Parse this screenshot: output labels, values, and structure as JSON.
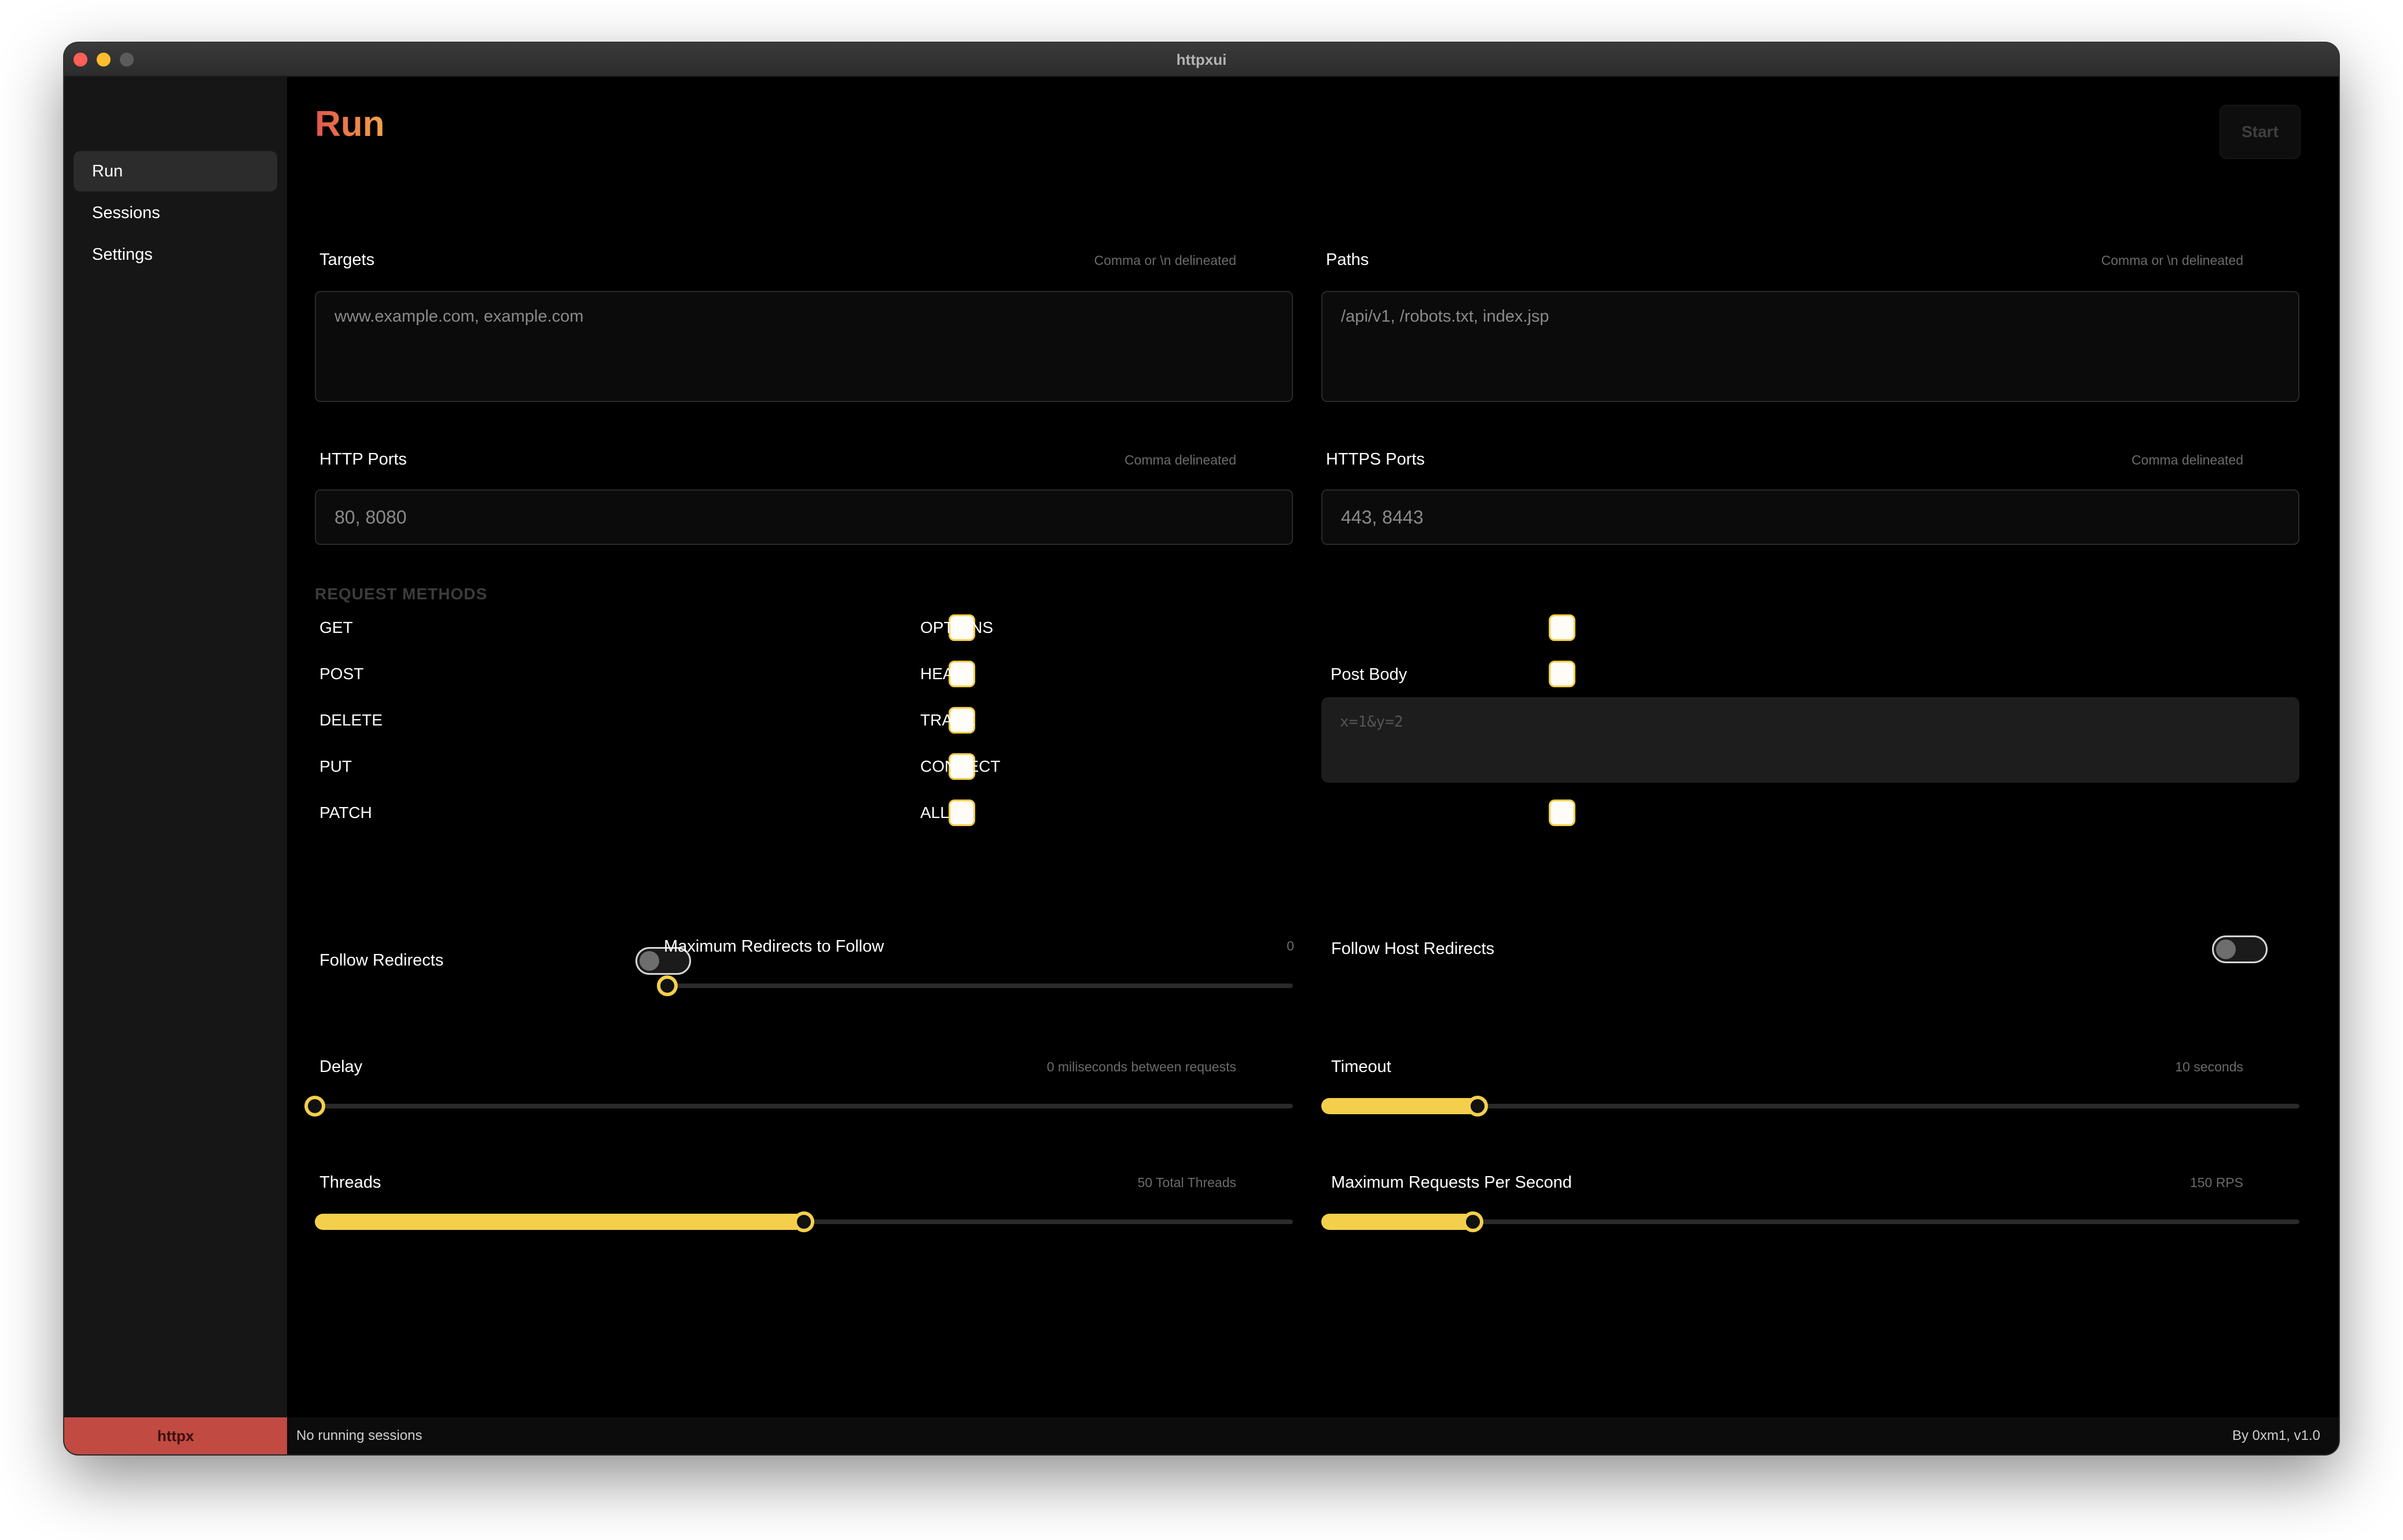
{
  "window": {
    "title": "httpxui"
  },
  "sidebar": {
    "items": [
      {
        "label": "Run",
        "active": true
      },
      {
        "label": "Sessions",
        "active": false
      },
      {
        "label": "Settings",
        "active": false
      }
    ]
  },
  "page": {
    "title": "Run",
    "start_label": "Start"
  },
  "targets": {
    "label": "Targets",
    "hint": "Comma or \\n delineated",
    "placeholder": "www.example.com, example.com"
  },
  "paths": {
    "label": "Paths",
    "hint": "Comma or \\n delineated",
    "placeholder": "/api/v1, /robots.txt, index.jsp"
  },
  "http_ports": {
    "label": "HTTP Ports",
    "hint": "Comma delineated",
    "placeholder": "80, 8080"
  },
  "https_ports": {
    "label": "HTTPS Ports",
    "hint": "Comma delineated",
    "placeholder": "443, 8443"
  },
  "methods": {
    "title": "REQUEST METHODS",
    "left": [
      "GET",
      "POST",
      "DELETE",
      "PUT",
      "PATCH"
    ],
    "right": [
      "OPTIONS",
      "HEAD",
      "TRACE",
      "CONNECT",
      "ALL"
    ]
  },
  "post_body": {
    "label": "Post Body",
    "placeholder": "x=1&y=2"
  },
  "follow_redirects": {
    "label": "Follow Redirects",
    "on": false
  },
  "max_redirects": {
    "label": "Maximum Redirects to Follow",
    "value_text": "0",
    "fraction": 0.0
  },
  "follow_host_redirects": {
    "label": "Follow Host Redirects",
    "on": false
  },
  "delay": {
    "label": "Delay",
    "hint": "0 miliseconds between requests",
    "fraction": 0.0
  },
  "timeout": {
    "label": "Timeout",
    "hint": "10 seconds",
    "fraction": 0.16
  },
  "threads": {
    "label": "Threads",
    "hint": "50 Total Threads",
    "fraction": 0.5
  },
  "max_rps": {
    "label": "Maximum Requests Per Second",
    "hint": "150 RPS",
    "fraction": 0.155
  },
  "status": {
    "brand": "httpx",
    "sessions": "No running sessions",
    "credit": "By 0xm1, v1.0"
  },
  "colors": {
    "accent": "#f4cf4b",
    "brand_bg": "#c14a43",
    "title_start": "#e2564a",
    "title_end": "#f3a44a"
  }
}
